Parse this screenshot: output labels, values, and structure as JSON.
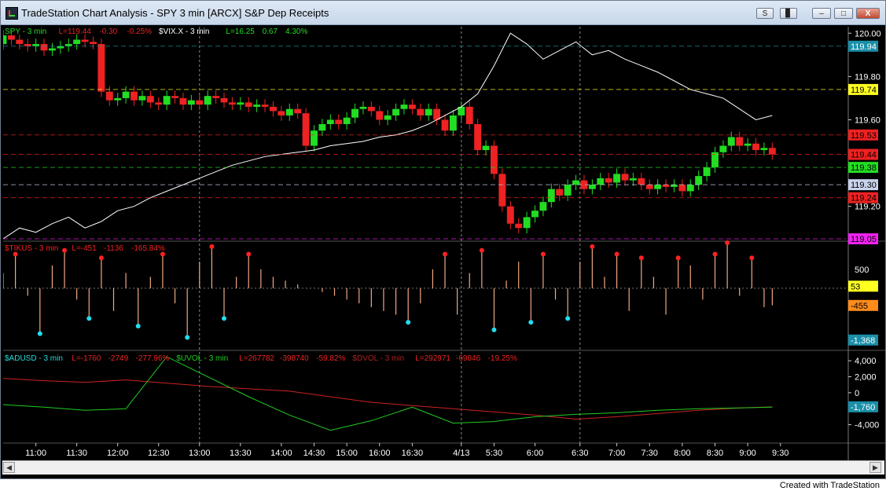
{
  "window": {
    "title": "TradeStation Chart Analysis - SPY 3 min [ARCX] S&P Dep Receipts",
    "btn_s": "S",
    "btn_grid": "▊",
    "btn_min": "–",
    "btn_max": "□",
    "btn_close": "X"
  },
  "footer": "Created with TradeStation",
  "colors": {
    "background": "#000000",
    "candle_up": "#22dd22",
    "candle_down": "#ee2222",
    "vix": "#ffffff",
    "tick_bars": "#f0a880",
    "up_dots": "#ff2222",
    "down_dots": "#22ddee",
    "advance_decline": "#cc2222",
    "uvol": "#22cc22"
  },
  "chart_data": [
    {
      "type": "line",
      "panel": "price",
      "legend": [
        {
          "text": "SPY - 3 min",
          "color": "#22dd22"
        },
        {
          "text": "L=119.44",
          "color": "#ee2222"
        },
        {
          "text": "-0.30",
          "color": "#ee2222"
        },
        {
          "text": "-0.25%",
          "color": "#ee2222"
        },
        {
          "text": "$VIX.X - 3 min",
          "color": "#ffffff"
        },
        {
          "text": "L=16.25",
          "color": "#22dd22"
        },
        {
          "text": "0.67",
          "color": "#22dd22"
        },
        {
          "text": "4.30%",
          "color": "#22dd22"
        }
      ],
      "ylim": [
        119.05,
        120.03
      ],
      "yticks": [
        119.2,
        119.4,
        119.6,
        119.8,
        120.0
      ],
      "ytick_labels": [
        "119.20",
        "",
        "119.60",
        "119.80",
        "120.00"
      ],
      "price_tags": [
        {
          "label": "119.94",
          "value": 119.94,
          "bg": "#1a8fa8",
          "fg": "#ffffff"
        },
        {
          "label": "119.74",
          "value": 119.74,
          "bg": "#ffff22",
          "fg": "#000000"
        },
        {
          "label": "119.53",
          "value": 119.53,
          "bg": "#ee2222",
          "fg": "#000000"
        },
        {
          "label": "119.44",
          "value": 119.44,
          "bg": "#ee2222",
          "fg": "#000000"
        },
        {
          "label": "119.38",
          "value": 119.38,
          "bg": "#22dd22",
          "fg": "#000000"
        },
        {
          "label": "119.30",
          "value": 119.3,
          "bg": "#c8d2ec",
          "fg": "#000000"
        },
        {
          "label": "119.24",
          "value": 119.24,
          "bg": "#ee2222",
          "fg": "#000000"
        },
        {
          "label": "119.05",
          "value": 119.05,
          "bg": "#ee22ee",
          "fg": "#000000"
        }
      ],
      "series": [
        {
          "name": "SPY - 3 min",
          "style": "candles",
          "x": [
            0,
            2,
            4,
            6,
            8,
            10,
            12,
            14,
            16,
            18,
            20,
            22,
            24,
            26,
            28,
            30,
            32,
            34,
            36,
            38,
            40,
            42,
            44,
            46,
            48,
            50,
            52,
            54,
            56,
            58,
            60,
            62,
            64,
            66,
            68,
            70,
            72,
            74,
            76,
            78,
            80,
            82,
            84,
            86,
            88,
            90,
            92,
            94,
            96,
            98,
            100,
            102,
            104,
            106,
            108,
            110,
            112,
            114,
            116,
            118,
            120,
            122,
            124,
            126,
            128,
            130,
            132,
            134,
            136,
            138,
            140,
            142,
            144,
            146,
            148,
            150,
            152,
            154,
            156,
            158,
            160,
            162,
            164,
            166,
            168,
            170,
            172,
            174,
            176,
            178,
            180,
            182,
            184,
            186,
            188
          ],
          "close": [
            119.99,
            119.97,
            119.95,
            119.94,
            119.95,
            119.92,
            119.93,
            119.94,
            119.95,
            119.97,
            119.96,
            119.95,
            119.73,
            119.69,
            119.7,
            119.73,
            119.69,
            119.71,
            119.68,
            119.67,
            119.71,
            119.7,
            119.67,
            119.69,
            119.67,
            119.71,
            119.7,
            119.68,
            119.67,
            119.68,
            119.66,
            119.67,
            119.66,
            119.64,
            119.62,
            119.65,
            119.63,
            119.48,
            119.55,
            119.58,
            119.6,
            119.58,
            119.61,
            119.65,
            119.66,
            119.64,
            119.6,
            119.62,
            119.65,
            119.67,
            119.65,
            119.62,
            119.65,
            119.6,
            119.55,
            119.62,
            119.66,
            119.58,
            119.46,
            119.48,
            119.35,
            119.2,
            119.12,
            119.1,
            119.15,
            119.18,
            119.22,
            119.28,
            119.25,
            119.3,
            119.32,
            119.28,
            119.3,
            119.33,
            119.31,
            119.35,
            119.32,
            119.33,
            119.3,
            119.28,
            119.3,
            119.29,
            119.3,
            119.27,
            119.3,
            119.34,
            119.38,
            119.45,
            119.48,
            119.52,
            119.48,
            119.49,
            119.46,
            119.47,
            119.44
          ],
          "open": [
            119.95,
            119.99,
            119.97,
            119.95,
            119.94,
            119.95,
            119.92,
            119.93,
            119.94,
            119.95,
            119.97,
            119.96,
            119.95,
            119.73,
            119.69,
            119.7,
            119.73,
            119.69,
            119.71,
            119.68,
            119.67,
            119.71,
            119.7,
            119.67,
            119.69,
            119.67,
            119.71,
            119.7,
            119.68,
            119.67,
            119.68,
            119.66,
            119.67,
            119.66,
            119.64,
            119.62,
            119.65,
            119.63,
            119.48,
            119.55,
            119.58,
            119.6,
            119.58,
            119.61,
            119.65,
            119.66,
            119.64,
            119.6,
            119.62,
            119.65,
            119.67,
            119.65,
            119.62,
            119.65,
            119.6,
            119.55,
            119.62,
            119.66,
            119.58,
            119.46,
            119.48,
            119.35,
            119.2,
            119.12,
            119.1,
            119.15,
            119.18,
            119.22,
            119.28,
            119.25,
            119.3,
            119.32,
            119.28,
            119.3,
            119.33,
            119.31,
            119.35,
            119.32,
            119.33,
            119.3,
            119.28,
            119.3,
            119.29,
            119.3,
            119.27,
            119.3,
            119.34,
            119.38,
            119.45,
            119.48,
            119.52,
            119.48,
            119.49,
            119.46,
            119.47
          ]
        },
        {
          "name": "$VIX.X - 3 min",
          "style": "line",
          "x": [
            0,
            4,
            8,
            12,
            16,
            20,
            24,
            28,
            32,
            36,
            40,
            44,
            48,
            52,
            56,
            60,
            64,
            68,
            72,
            76,
            80,
            84,
            88,
            92,
            96,
            100,
            104,
            108,
            112,
            116,
            120,
            124,
            128,
            132,
            136,
            140,
            144,
            148,
            152,
            156,
            160,
            164,
            168,
            172,
            176,
            180,
            184,
            188
          ],
          "y": [
            119.05,
            119.1,
            119.08,
            119.12,
            119.15,
            119.1,
            119.13,
            119.18,
            119.2,
            119.24,
            119.27,
            119.3,
            119.33,
            119.36,
            119.39,
            119.41,
            119.43,
            119.44,
            119.45,
            119.46,
            119.48,
            119.49,
            119.5,
            119.52,
            119.53,
            119.55,
            119.58,
            119.62,
            119.66,
            119.72,
            119.85,
            120.0,
            119.95,
            119.88,
            119.92,
            119.96,
            119.9,
            119.92,
            119.88,
            119.85,
            119.82,
            119.78,
            119.74,
            119.72,
            119.7,
            119.65,
            119.6,
            119.62
          ]
        }
      ]
    },
    {
      "type": "bar",
      "panel": "tick",
      "legend": [
        {
          "text": "$TIKUS - 3 min",
          "color": "#ee2222"
        },
        {
          "text": "L=-451",
          "color": "#ee2222"
        },
        {
          "text": "-1136",
          "color": "#ee2222"
        },
        {
          "text": "-165.84%",
          "color": "#ee2222"
        }
      ],
      "ylim": [
        -1600,
        1200
      ],
      "yticks": [
        500
      ],
      "ytick_labels": [
        "500"
      ],
      "tags": [
        {
          "label": "53",
          "value": 53,
          "bg": "#ffff22",
          "fg": "#000000"
        },
        {
          "label": "-455",
          "value": -455,
          "bg": "#ff8c1a",
          "fg": "#000000"
        },
        {
          "label": "-1,368",
          "value": -1368,
          "bg": "#1a8fa8",
          "fg": "#ffffff"
        }
      ],
      "x": [
        0,
        3,
        6,
        9,
        12,
        15,
        18,
        21,
        24,
        27,
        30,
        33,
        36,
        39,
        42,
        45,
        48,
        51,
        54,
        57,
        60,
        63,
        66,
        69,
        72,
        75,
        78,
        81,
        84,
        87,
        90,
        93,
        96,
        99,
        102,
        105,
        108,
        111,
        114,
        117,
        120,
        123,
        126,
        129,
        132,
        135,
        138,
        141,
        144,
        147,
        150,
        153,
        156,
        159,
        162,
        165,
        168,
        171,
        174,
        177,
        180,
        183,
        186,
        188
      ],
      "values": [
        400,
        900,
        -200,
        -1200,
        600,
        1000,
        -300,
        -800,
        800,
        -600,
        400,
        -1000,
        300,
        900,
        -400,
        -1300,
        700,
        1100,
        -800,
        300,
        900,
        500,
        300,
        200,
        100,
        0,
        -100,
        -200,
        -300,
        -400,
        -500,
        -600,
        -700,
        -900,
        -400,
        500,
        900,
        -700,
        400,
        1000,
        -1100,
        200,
        700,
        -900,
        900,
        -300,
        -800,
        700,
        1100,
        300,
        900,
        -600,
        800,
        300,
        -700,
        800,
        600,
        -300,
        900,
        1200,
        -200,
        800,
        -500,
        -451
      ]
    },
    {
      "type": "line",
      "panel": "breadth",
      "legend": [
        {
          "text": "$ADUSD - 3 min",
          "color": "#22dddd"
        },
        {
          "text": "L=-1760",
          "color": "#ee2222"
        },
        {
          "text": "-2749",
          "color": "#ee2222"
        },
        {
          "text": "-277.96%",
          "color": "#ee2222"
        },
        {
          "text": "$UVOL - 3 min",
          "color": "#22cc22"
        },
        {
          "text": "L=267782",
          "color": "#ee2222"
        },
        {
          "text": "-398740",
          "color": "#ee2222"
        },
        {
          "text": "-59.82%",
          "color": "#ee2222"
        },
        {
          "text": "$DVOL - 3 min",
          "color": "#aa2222"
        },
        {
          "text": "L=292971",
          "color": "#ee2222"
        },
        {
          "text": "-69846",
          "color": "#ee2222"
        },
        {
          "text": "-19.25%",
          "color": "#ee2222"
        }
      ],
      "ylim": [
        -6000,
        5000
      ],
      "yticks": [
        -4000,
        0,
        2000,
        4000
      ],
      "ytick_labels": [
        "-4,000",
        "0",
        "2,000",
        "4,000"
      ],
      "tags": [
        {
          "label": "-1,760",
          "value": -1760,
          "bg": "#1a8fa8",
          "fg": "#ffffff"
        }
      ],
      "series": [
        {
          "name": "$ADUSD - 3 min",
          "x": [
            0,
            10,
            20,
            30,
            40,
            50,
            60,
            70,
            80,
            90,
            100,
            110,
            120,
            130,
            140,
            150,
            160,
            170,
            180,
            188
          ],
          "y": [
            1800,
            1500,
            1300,
            1600,
            1200,
            800,
            500,
            200,
            -500,
            -1200,
            -1600,
            -2000,
            -2400,
            -2800,
            -3300,
            -3000,
            -2600,
            -2200,
            -1900,
            -1760
          ]
        },
        {
          "name": "$UVOL - 3 min",
          "x": [
            0,
            10,
            20,
            30,
            40,
            50,
            60,
            70,
            80,
            90,
            100,
            110,
            120,
            130,
            140,
            150,
            160,
            170,
            180,
            188
          ],
          "y": [
            -1500,
            -1800,
            -2200,
            -2000,
            4500,
            2000,
            -500,
            -2800,
            -4700,
            -3500,
            -1800,
            -3800,
            -3600,
            -3000,
            -2700,
            -2500,
            -2200,
            -2000,
            -1900,
            -1800
          ]
        }
      ]
    }
  ],
  "x_axis": {
    "ticks": [
      {
        "label": "11:00",
        "x": 8
      },
      {
        "label": "11:30",
        "x": 18
      },
      {
        "label": "12:00",
        "x": 28
      },
      {
        "label": "12:30",
        "x": 38
      },
      {
        "label": "13:00",
        "x": 48
      },
      {
        "label": "13:30",
        "x": 58
      },
      {
        "label": "14:00",
        "x": 68
      },
      {
        "label": "14:30",
        "x": 76
      },
      {
        "label": "15:00",
        "x": 84
      },
      {
        "label": "16:00",
        "x": 92
      },
      {
        "label": "16:30",
        "x": 100
      },
      {
        "label": "4/13",
        "x": 112
      },
      {
        "label": "5:30",
        "x": 120
      },
      {
        "label": "6:00",
        "x": 130
      },
      {
        "label": "6:30",
        "x": 141
      },
      {
        "label": "7:00",
        "x": 150
      },
      {
        "label": "7:30",
        "x": 158
      },
      {
        "label": "8:00",
        "x": 166
      },
      {
        "label": "8:30",
        "x": 174
      },
      {
        "label": "9:00",
        "x": 182
      },
      {
        "label": "9:30",
        "x": 190
      }
    ],
    "xlim": [
      0,
      206
    ]
  }
}
